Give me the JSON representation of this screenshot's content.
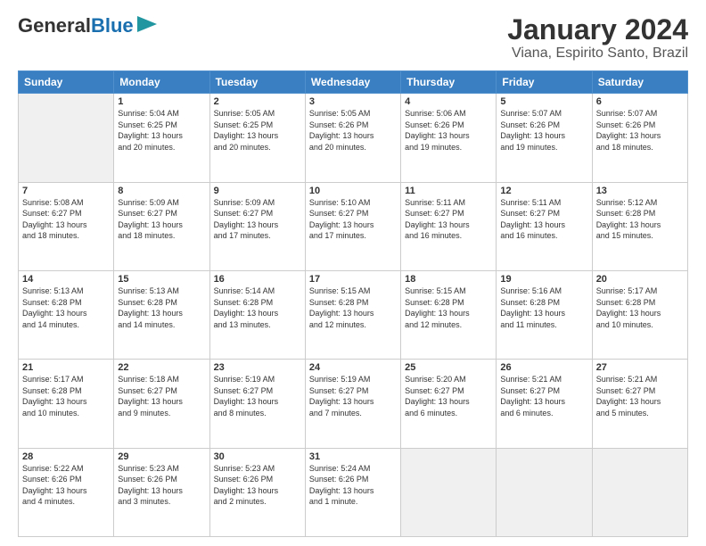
{
  "logo": {
    "text_general": "General",
    "text_blue": "Blue"
  },
  "title": "January 2024",
  "subtitle": "Viana, Espirito Santo, Brazil",
  "days_header": [
    "Sunday",
    "Monday",
    "Tuesday",
    "Wednesday",
    "Thursday",
    "Friday",
    "Saturday"
  ],
  "weeks": [
    [
      {
        "day": "",
        "info": ""
      },
      {
        "day": "1",
        "info": "Sunrise: 5:04 AM\nSunset: 6:25 PM\nDaylight: 13 hours\nand 20 minutes."
      },
      {
        "day": "2",
        "info": "Sunrise: 5:05 AM\nSunset: 6:25 PM\nDaylight: 13 hours\nand 20 minutes."
      },
      {
        "day": "3",
        "info": "Sunrise: 5:05 AM\nSunset: 6:26 PM\nDaylight: 13 hours\nand 20 minutes."
      },
      {
        "day": "4",
        "info": "Sunrise: 5:06 AM\nSunset: 6:26 PM\nDaylight: 13 hours\nand 19 minutes."
      },
      {
        "day": "5",
        "info": "Sunrise: 5:07 AM\nSunset: 6:26 PM\nDaylight: 13 hours\nand 19 minutes."
      },
      {
        "day": "6",
        "info": "Sunrise: 5:07 AM\nSunset: 6:26 PM\nDaylight: 13 hours\nand 18 minutes."
      }
    ],
    [
      {
        "day": "7",
        "info": "Sunrise: 5:08 AM\nSunset: 6:27 PM\nDaylight: 13 hours\nand 18 minutes."
      },
      {
        "day": "8",
        "info": "Sunrise: 5:09 AM\nSunset: 6:27 PM\nDaylight: 13 hours\nand 18 minutes."
      },
      {
        "day": "9",
        "info": "Sunrise: 5:09 AM\nSunset: 6:27 PM\nDaylight: 13 hours\nand 17 minutes."
      },
      {
        "day": "10",
        "info": "Sunrise: 5:10 AM\nSunset: 6:27 PM\nDaylight: 13 hours\nand 17 minutes."
      },
      {
        "day": "11",
        "info": "Sunrise: 5:11 AM\nSunset: 6:27 PM\nDaylight: 13 hours\nand 16 minutes."
      },
      {
        "day": "12",
        "info": "Sunrise: 5:11 AM\nSunset: 6:27 PM\nDaylight: 13 hours\nand 16 minutes."
      },
      {
        "day": "13",
        "info": "Sunrise: 5:12 AM\nSunset: 6:28 PM\nDaylight: 13 hours\nand 15 minutes."
      }
    ],
    [
      {
        "day": "14",
        "info": "Sunrise: 5:13 AM\nSunset: 6:28 PM\nDaylight: 13 hours\nand 14 minutes."
      },
      {
        "day": "15",
        "info": "Sunrise: 5:13 AM\nSunset: 6:28 PM\nDaylight: 13 hours\nand 14 minutes."
      },
      {
        "day": "16",
        "info": "Sunrise: 5:14 AM\nSunset: 6:28 PM\nDaylight: 13 hours\nand 13 minutes."
      },
      {
        "day": "17",
        "info": "Sunrise: 5:15 AM\nSunset: 6:28 PM\nDaylight: 13 hours\nand 12 minutes."
      },
      {
        "day": "18",
        "info": "Sunrise: 5:15 AM\nSunset: 6:28 PM\nDaylight: 13 hours\nand 12 minutes."
      },
      {
        "day": "19",
        "info": "Sunrise: 5:16 AM\nSunset: 6:28 PM\nDaylight: 13 hours\nand 11 minutes."
      },
      {
        "day": "20",
        "info": "Sunrise: 5:17 AM\nSunset: 6:28 PM\nDaylight: 13 hours\nand 10 minutes."
      }
    ],
    [
      {
        "day": "21",
        "info": "Sunrise: 5:17 AM\nSunset: 6:28 PM\nDaylight: 13 hours\nand 10 minutes."
      },
      {
        "day": "22",
        "info": "Sunrise: 5:18 AM\nSunset: 6:27 PM\nDaylight: 13 hours\nand 9 minutes."
      },
      {
        "day": "23",
        "info": "Sunrise: 5:19 AM\nSunset: 6:27 PM\nDaylight: 13 hours\nand 8 minutes."
      },
      {
        "day": "24",
        "info": "Sunrise: 5:19 AM\nSunset: 6:27 PM\nDaylight: 13 hours\nand 7 minutes."
      },
      {
        "day": "25",
        "info": "Sunrise: 5:20 AM\nSunset: 6:27 PM\nDaylight: 13 hours\nand 6 minutes."
      },
      {
        "day": "26",
        "info": "Sunrise: 5:21 AM\nSunset: 6:27 PM\nDaylight: 13 hours\nand 6 minutes."
      },
      {
        "day": "27",
        "info": "Sunrise: 5:21 AM\nSunset: 6:27 PM\nDaylight: 13 hours\nand 5 minutes."
      }
    ],
    [
      {
        "day": "28",
        "info": "Sunrise: 5:22 AM\nSunset: 6:26 PM\nDaylight: 13 hours\nand 4 minutes."
      },
      {
        "day": "29",
        "info": "Sunrise: 5:23 AM\nSunset: 6:26 PM\nDaylight: 13 hours\nand 3 minutes."
      },
      {
        "day": "30",
        "info": "Sunrise: 5:23 AM\nSunset: 6:26 PM\nDaylight: 13 hours\nand 2 minutes."
      },
      {
        "day": "31",
        "info": "Sunrise: 5:24 AM\nSunset: 6:26 PM\nDaylight: 13 hours\nand 1 minute."
      },
      {
        "day": "",
        "info": ""
      },
      {
        "day": "",
        "info": ""
      },
      {
        "day": "",
        "info": ""
      }
    ]
  ]
}
